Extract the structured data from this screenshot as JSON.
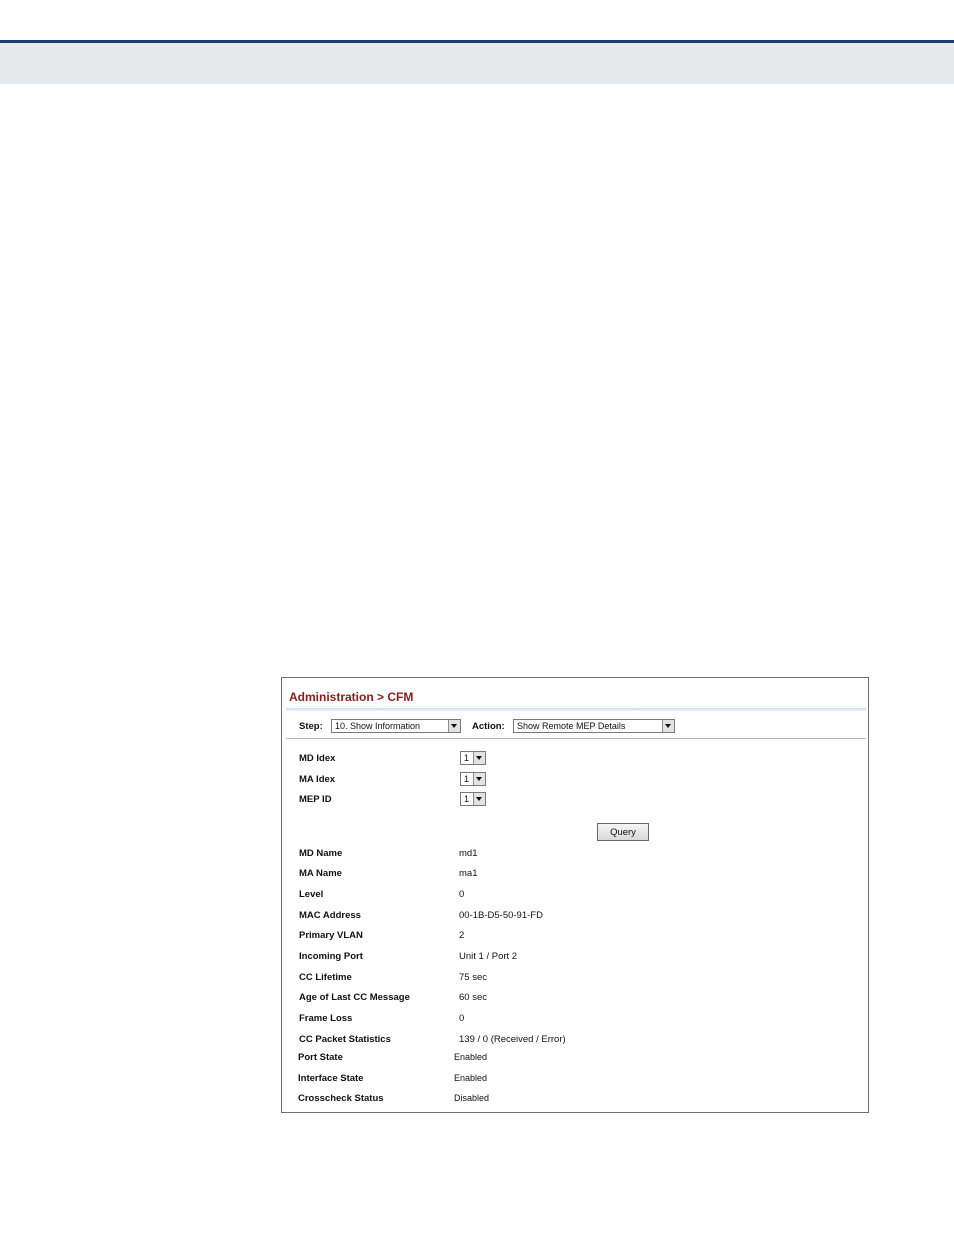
{
  "panel": {
    "title": "Administration > CFM",
    "step": {
      "label": "Step:",
      "value": "10. Show Information"
    },
    "action": {
      "label": "Action:",
      "value": "Show Remote MEP Details"
    },
    "selectors": [
      {
        "label": "MD Idex",
        "value": "1"
      },
      {
        "label": "MA Idex",
        "value": "1"
      },
      {
        "label": "MEP ID",
        "value": "1"
      }
    ],
    "query_label": "Query",
    "details": [
      {
        "label": "MD Name",
        "value": "md1"
      },
      {
        "label": "MA Name",
        "value": "ma1"
      },
      {
        "label": "Level",
        "value": "0"
      },
      {
        "label": "MAC Address",
        "value": "00-1B-D5-50-91-FD"
      },
      {
        "label": "Primary VLAN",
        "value": "2"
      },
      {
        "label": "Incoming Port",
        "value": "Unit 1 / Port 2"
      },
      {
        "label": "CC Lifetime",
        "value": "75 sec"
      },
      {
        "label": "Age of Last CC Message",
        "value": "60 sec"
      },
      {
        "label": "Frame Loss",
        "value": "0"
      },
      {
        "label": "CC Packet Statistics",
        "value": "139 / 0 (Received / Error)"
      },
      {
        "label": "Port State",
        "value": "Enabled"
      },
      {
        "label": "Interface State",
        "value": "Enabled"
      },
      {
        "label": "Crosscheck Status",
        "value": "Disabled"
      }
    ]
  }
}
